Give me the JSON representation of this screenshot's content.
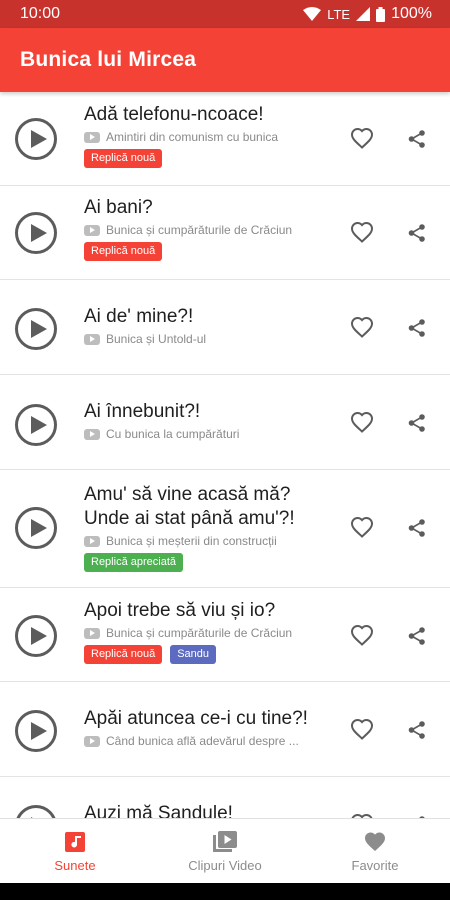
{
  "status_bar": {
    "time": "10:00",
    "network": "LTE",
    "battery": "100%"
  },
  "app_bar": {
    "title": "Bunica lui Mircea"
  },
  "items": [
    {
      "title": "Adă telefonu-ncoace!",
      "source": "Amintiri din comunism cu bunica",
      "badges": [
        {
          "label": "Replică nouă",
          "color": "#f44336"
        }
      ]
    },
    {
      "title": "Ai bani?",
      "source": "Bunica și cumpărăturile de Crăciun",
      "badges": [
        {
          "label": "Replică nouă",
          "color": "#f44336"
        }
      ]
    },
    {
      "title": "Ai de' mine?!",
      "source": "Bunica și Untold-ul",
      "badges": []
    },
    {
      "title": "Ai înnebunit?!",
      "source": "Cu bunica la cumpărături",
      "badges": []
    },
    {
      "title": "Amu' să vine acasă mă? Unde ai stat până amu'?!",
      "source": "Bunica și meșterii din construcții",
      "badges": [
        {
          "label": "Replică apreciată",
          "color": "#4caf50"
        }
      ]
    },
    {
      "title": "Apoi trebe să viu și io?",
      "source": "Bunica și cumpărăturile de Crăciun",
      "badges": [
        {
          "label": "Replică nouă",
          "color": "#f44336"
        },
        {
          "label": "Sandu",
          "color": "#5c6bc0"
        }
      ]
    },
    {
      "title": "Apăi atuncea ce-i cu tine?!",
      "source": "Când bunica află adevărul despre ...",
      "badges": []
    },
    {
      "title": "Auzi mă Sandule!",
      "source": "",
      "badges": []
    }
  ],
  "bottom_nav": [
    {
      "label": "Sunete",
      "icon": "music-note-icon",
      "active": true
    },
    {
      "label": "Clipuri Video",
      "icon": "video-library-icon",
      "active": false
    },
    {
      "label": "Favorite",
      "icon": "heart-icon",
      "active": false
    }
  ],
  "colors": {
    "accent": "#f44336",
    "status_bar": "#c8322d",
    "badge_new": "#f44336",
    "badge_liked": "#4caf50",
    "badge_person": "#5c6bc0"
  }
}
